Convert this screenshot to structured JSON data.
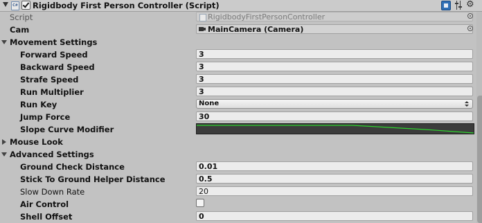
{
  "header": {
    "title": "Rigidbody First Person Controller (Script)",
    "script_icon_text": "C#",
    "icons": [
      "fold-arrow-icon",
      "csharp-script-icon",
      "enable-checkbox-icon",
      "help-book-icon",
      "preset-sliders-icon",
      "gear-icon"
    ]
  },
  "script": {
    "label": "Script",
    "value": "RigidbodyFirstPersonController"
  },
  "cam": {
    "label": "Cam",
    "value": "MainCamera (Camera)"
  },
  "movement": {
    "label": "Movement Settings",
    "forward_speed": {
      "label": "Forward Speed",
      "value": "3"
    },
    "backward_speed": {
      "label": "Backward Speed",
      "value": "3"
    },
    "strafe_speed": {
      "label": "Strafe Speed",
      "value": "3"
    },
    "run_multiplier": {
      "label": "Run Multiplier",
      "value": "3"
    },
    "run_key": {
      "label": "Run Key",
      "value": "None"
    },
    "jump_force": {
      "label": "Jump Force",
      "value": "30"
    },
    "slope_curve": {
      "label": "Slope Curve Modifier",
      "curve_color": "#2ed62e"
    }
  },
  "mouse_look": {
    "label": "Mouse Look"
  },
  "advanced": {
    "label": "Advanced Settings",
    "ground_check_distance": {
      "label": "Ground Check Distance",
      "value": "0.01"
    },
    "stick_to_ground": {
      "label": "Stick To Ground Helper Distance",
      "value": "0.5"
    },
    "slow_down_rate": {
      "label": "Slow Down Rate",
      "value": "20"
    },
    "air_control": {
      "label": "Air Control",
      "checked": false
    },
    "shell_offset": {
      "label": "Shell Offset",
      "value": "0"
    }
  },
  "colors": {
    "background": "#c2c2c2",
    "field": "#ececec",
    "curve_bg": "#3c3c3c",
    "help_icon": "#2f6fb5"
  }
}
